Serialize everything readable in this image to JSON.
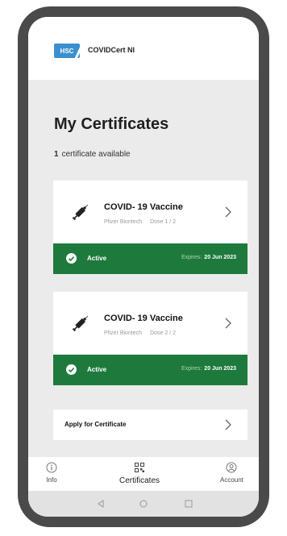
{
  "header": {
    "logo_text": "HSC",
    "app_name": "COVIDCert NI"
  },
  "main": {
    "title": "My Certificates",
    "count": "1",
    "count_text": "certificate available",
    "certificates": [
      {
        "title": "COVID- 19 Vaccine",
        "manufacturer": "Pfizer Biontech",
        "dose": "Dose 1 / 2",
        "status": "Active",
        "expires_label": "Expires:",
        "expires_date": "20 Jun 2023"
      },
      {
        "title": "COVID- 19 Vaccine",
        "manufacturer": "Pfizer Biontech",
        "dose": "Dose 2 / 2",
        "status": "Active",
        "expires_label": "Expires:",
        "expires_date": "20 Jun 2023"
      }
    ],
    "apply_label": "Apply for Certificate"
  },
  "bottom_nav": {
    "items": [
      {
        "label": "Info",
        "icon": "info-icon"
      },
      {
        "label": "Certificates",
        "icon": "qr-code-icon"
      },
      {
        "label": "Account",
        "icon": "account-icon"
      }
    ]
  },
  "colors": {
    "status_green": "#1e7a3c",
    "logo_blue": "#3b8fce",
    "phone_frame": "#4a4a4a"
  }
}
